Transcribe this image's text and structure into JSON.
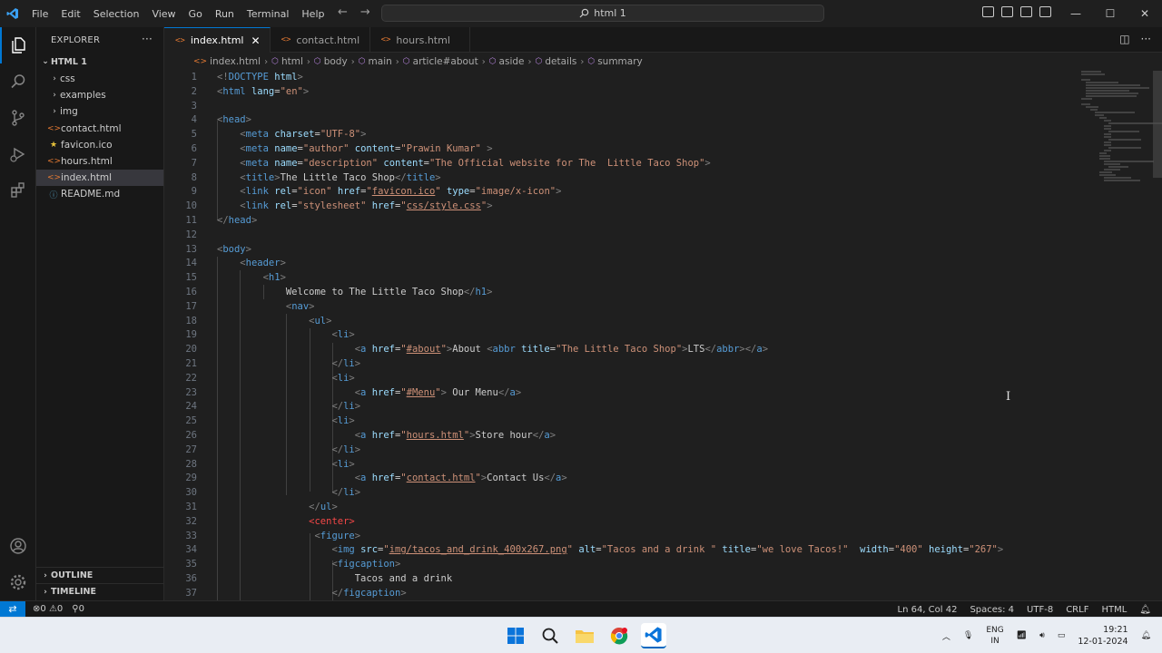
{
  "titlebar": {
    "menu": [
      "File",
      "Edit",
      "Selection",
      "View",
      "Go",
      "Run",
      "Terminal",
      "Help"
    ],
    "search_text": "html 1"
  },
  "sidebar": {
    "title": "EXPLORER",
    "root": "HTML 1",
    "items": [
      {
        "label": "css",
        "type": "folder"
      },
      {
        "label": "examples",
        "type": "folder"
      },
      {
        "label": "img",
        "type": "folder"
      },
      {
        "label": "contact.html",
        "type": "html"
      },
      {
        "label": "favicon.ico",
        "type": "ico"
      },
      {
        "label": "hours.html",
        "type": "html"
      },
      {
        "label": "index.html",
        "type": "html",
        "selected": true
      },
      {
        "label": "README.md",
        "type": "md"
      }
    ],
    "outline": "OUTLINE",
    "timeline": "TIMELINE"
  },
  "tabs": [
    {
      "label": "index.html",
      "active": true
    },
    {
      "label": "contact.html",
      "active": false
    },
    {
      "label": "hours.html",
      "active": false
    }
  ],
  "breadcrumb": [
    "index.html",
    "html",
    "body",
    "main",
    "article#about",
    "aside",
    "details",
    "summary"
  ],
  "editor": {
    "line_numbers": [
      1,
      2,
      3,
      4,
      5,
      6,
      7,
      8,
      9,
      10,
      11,
      12,
      13,
      14,
      15,
      16,
      17,
      18,
      19,
      20,
      21,
      22,
      23,
      24,
      25,
      26,
      27,
      28,
      29,
      30,
      31,
      32,
      33,
      34,
      35,
      36,
      37
    ]
  },
  "statusbar": {
    "errors": "0",
    "warnings": "0",
    "ports": "0",
    "position": "Ln 64, Col 42",
    "spaces": "Spaces: 4",
    "encoding": "UTF-8",
    "eol": "CRLF",
    "language": "HTML"
  },
  "taskbar": {
    "lang_top": "ENG",
    "lang_bottom": "IN",
    "time": "19:21",
    "date": "12-01-2024"
  },
  "colors": {
    "accent": "#0078d4",
    "tag": "#569cd6",
    "attribute": "#9cdcfe",
    "string": "#ce9178"
  }
}
